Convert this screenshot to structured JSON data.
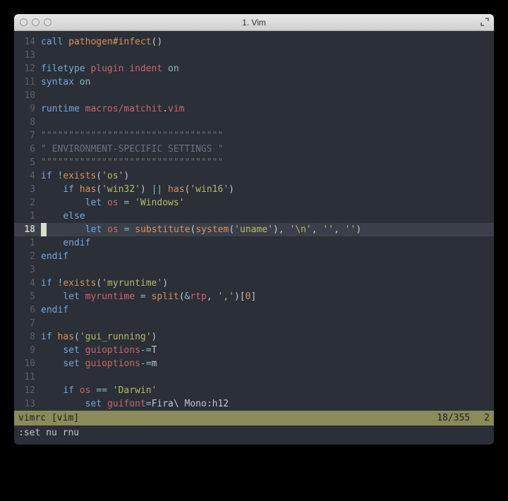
{
  "window": {
    "title": "1. Vim"
  },
  "editor": {
    "current_line_number": "18",
    "cursor_char": " ",
    "lines": [
      {
        "n": "14",
        "tokens": [
          [
            "kw",
            "call"
          ],
          [
            "punc",
            " "
          ],
          [
            "func",
            "pathogen#infect"
          ],
          [
            "punc",
            "()"
          ]
        ]
      },
      {
        "n": "13",
        "tokens": []
      },
      {
        "n": "12",
        "tokens": [
          [
            "kw",
            "filetype"
          ],
          [
            "punc",
            " "
          ],
          [
            "id",
            "plugin"
          ],
          [
            "punc",
            " "
          ],
          [
            "id",
            "indent"
          ],
          [
            "punc",
            " "
          ],
          [
            "op",
            "on"
          ]
        ]
      },
      {
        "n": "11",
        "tokens": [
          [
            "kw",
            "syntax"
          ],
          [
            "punc",
            " "
          ],
          [
            "op",
            "on"
          ]
        ]
      },
      {
        "n": "10",
        "tokens": []
      },
      {
        "n": "9",
        "tokens": [
          [
            "kw",
            "runtime"
          ],
          [
            "punc",
            " "
          ],
          [
            "id",
            "macros/matchit"
          ],
          [
            "punc",
            "."
          ],
          [
            "id",
            "vim"
          ]
        ]
      },
      {
        "n": "8",
        "tokens": []
      },
      {
        "n": "7",
        "tokens": [
          [
            "cmt",
            "\"\"\"\"\"\"\"\"\"\"\"\"\"\"\"\"\"\"\"\"\"\"\"\"\"\"\"\"\"\"\"\"\""
          ]
        ]
      },
      {
        "n": "6",
        "tokens": [
          [
            "cmt",
            "\" ENVIRONMENT-SPECIFIC SETTINGS \""
          ]
        ]
      },
      {
        "n": "5",
        "tokens": [
          [
            "cmt",
            "\"\"\"\"\"\"\"\"\"\"\"\"\"\"\"\"\"\"\"\"\"\"\"\"\"\"\"\"\"\"\"\"\""
          ]
        ]
      },
      {
        "n": "4",
        "tokens": [
          [
            "kw",
            "if"
          ],
          [
            "punc",
            " "
          ],
          [
            "op",
            "!"
          ],
          [
            "func",
            "exists"
          ],
          [
            "punc",
            "("
          ],
          [
            "str",
            "'os'"
          ],
          [
            "punc",
            ")"
          ]
        ]
      },
      {
        "n": "3",
        "tokens": [
          [
            "punc",
            "    "
          ],
          [
            "kw",
            "if"
          ],
          [
            "punc",
            " "
          ],
          [
            "func",
            "has"
          ],
          [
            "punc",
            "("
          ],
          [
            "str",
            "'win32'"
          ],
          [
            "punc",
            ") "
          ],
          [
            "op",
            "||"
          ],
          [
            "punc",
            " "
          ],
          [
            "func",
            "has"
          ],
          [
            "punc",
            "("
          ],
          [
            "str",
            "'win16'"
          ],
          [
            "punc",
            ")"
          ]
        ]
      },
      {
        "n": "2",
        "tokens": [
          [
            "punc",
            "        "
          ],
          [
            "kw",
            "let"
          ],
          [
            "punc",
            " "
          ],
          [
            "id",
            "os"
          ],
          [
            "punc",
            " "
          ],
          [
            "op",
            "="
          ],
          [
            "punc",
            " "
          ],
          [
            "str",
            "'Windows'"
          ]
        ]
      },
      {
        "n": "1",
        "tokens": [
          [
            "punc",
            "    "
          ],
          [
            "kw",
            "else"
          ]
        ]
      },
      {
        "n": "CURRENT",
        "tokens": [
          [
            "punc",
            "       "
          ],
          [
            "kw",
            "let"
          ],
          [
            "punc",
            " "
          ],
          [
            "id",
            "os"
          ],
          [
            "punc",
            " "
          ],
          [
            "op",
            "="
          ],
          [
            "punc",
            " "
          ],
          [
            "func",
            "substitute"
          ],
          [
            "punc",
            "("
          ],
          [
            "func",
            "system"
          ],
          [
            "punc",
            "("
          ],
          [
            "str",
            "'uname'"
          ],
          [
            "punc",
            "), "
          ],
          [
            "str",
            "'\\n'"
          ],
          [
            "punc",
            ", "
          ],
          [
            "str",
            "''"
          ],
          [
            "punc",
            ", "
          ],
          [
            "str",
            "''"
          ],
          [
            "punc",
            ")"
          ]
        ]
      },
      {
        "n": "1",
        "tokens": [
          [
            "punc",
            "    "
          ],
          [
            "kw",
            "endif"
          ]
        ]
      },
      {
        "n": "2",
        "tokens": [
          [
            "kw",
            "endif"
          ]
        ]
      },
      {
        "n": "3",
        "tokens": []
      },
      {
        "n": "4",
        "tokens": [
          [
            "kw",
            "if"
          ],
          [
            "punc",
            " "
          ],
          [
            "op",
            "!"
          ],
          [
            "func",
            "exists"
          ],
          [
            "punc",
            "("
          ],
          [
            "str",
            "'myruntime'"
          ],
          [
            "punc",
            ")"
          ]
        ]
      },
      {
        "n": "5",
        "tokens": [
          [
            "punc",
            "    "
          ],
          [
            "kw",
            "let"
          ],
          [
            "punc",
            " "
          ],
          [
            "id",
            "myruntime"
          ],
          [
            "punc",
            " "
          ],
          [
            "op",
            "="
          ],
          [
            "punc",
            " "
          ],
          [
            "func",
            "split"
          ],
          [
            "punc",
            "("
          ],
          [
            "op",
            "&"
          ],
          [
            "id",
            "rtp"
          ],
          [
            "punc",
            ", "
          ],
          [
            "str",
            "','"
          ],
          [
            "punc",
            ")["
          ],
          [
            "num",
            "0"
          ],
          [
            "punc",
            "]"
          ]
        ]
      },
      {
        "n": "6",
        "tokens": [
          [
            "kw",
            "endif"
          ]
        ]
      },
      {
        "n": "7",
        "tokens": []
      },
      {
        "n": "8",
        "tokens": [
          [
            "kw",
            "if"
          ],
          [
            "punc",
            " "
          ],
          [
            "func",
            "has"
          ],
          [
            "punc",
            "("
          ],
          [
            "str",
            "'gui_running'"
          ],
          [
            "punc",
            ")"
          ]
        ]
      },
      {
        "n": "9",
        "tokens": [
          [
            "punc",
            "    "
          ],
          [
            "kw",
            "set"
          ],
          [
            "punc",
            " "
          ],
          [
            "id",
            "guioptions"
          ],
          [
            "op",
            "-="
          ],
          [
            "punc",
            "T"
          ]
        ]
      },
      {
        "n": "10",
        "tokens": [
          [
            "punc",
            "    "
          ],
          [
            "kw",
            "set"
          ],
          [
            "punc",
            " "
          ],
          [
            "id",
            "guioptions"
          ],
          [
            "op",
            "-="
          ],
          [
            "punc",
            "m"
          ]
        ]
      },
      {
        "n": "11",
        "tokens": []
      },
      {
        "n": "12",
        "tokens": [
          [
            "punc",
            "    "
          ],
          [
            "kw",
            "if"
          ],
          [
            "punc",
            " "
          ],
          [
            "id",
            "os"
          ],
          [
            "punc",
            " "
          ],
          [
            "op",
            "=="
          ],
          [
            "punc",
            " "
          ],
          [
            "str",
            "'Darwin'"
          ]
        ]
      },
      {
        "n": "13",
        "tokens": [
          [
            "punc",
            "        "
          ],
          [
            "kw",
            "set"
          ],
          [
            "punc",
            " "
          ],
          [
            "id",
            "guifont"
          ],
          [
            "op",
            "="
          ],
          [
            "punc",
            "Fira\\ Mono:h12"
          ]
        ]
      }
    ]
  },
  "status": {
    "filename": " vimrc [vim]",
    "position": "18/355",
    "col": "2"
  },
  "cmdline": ":set nu rnu"
}
